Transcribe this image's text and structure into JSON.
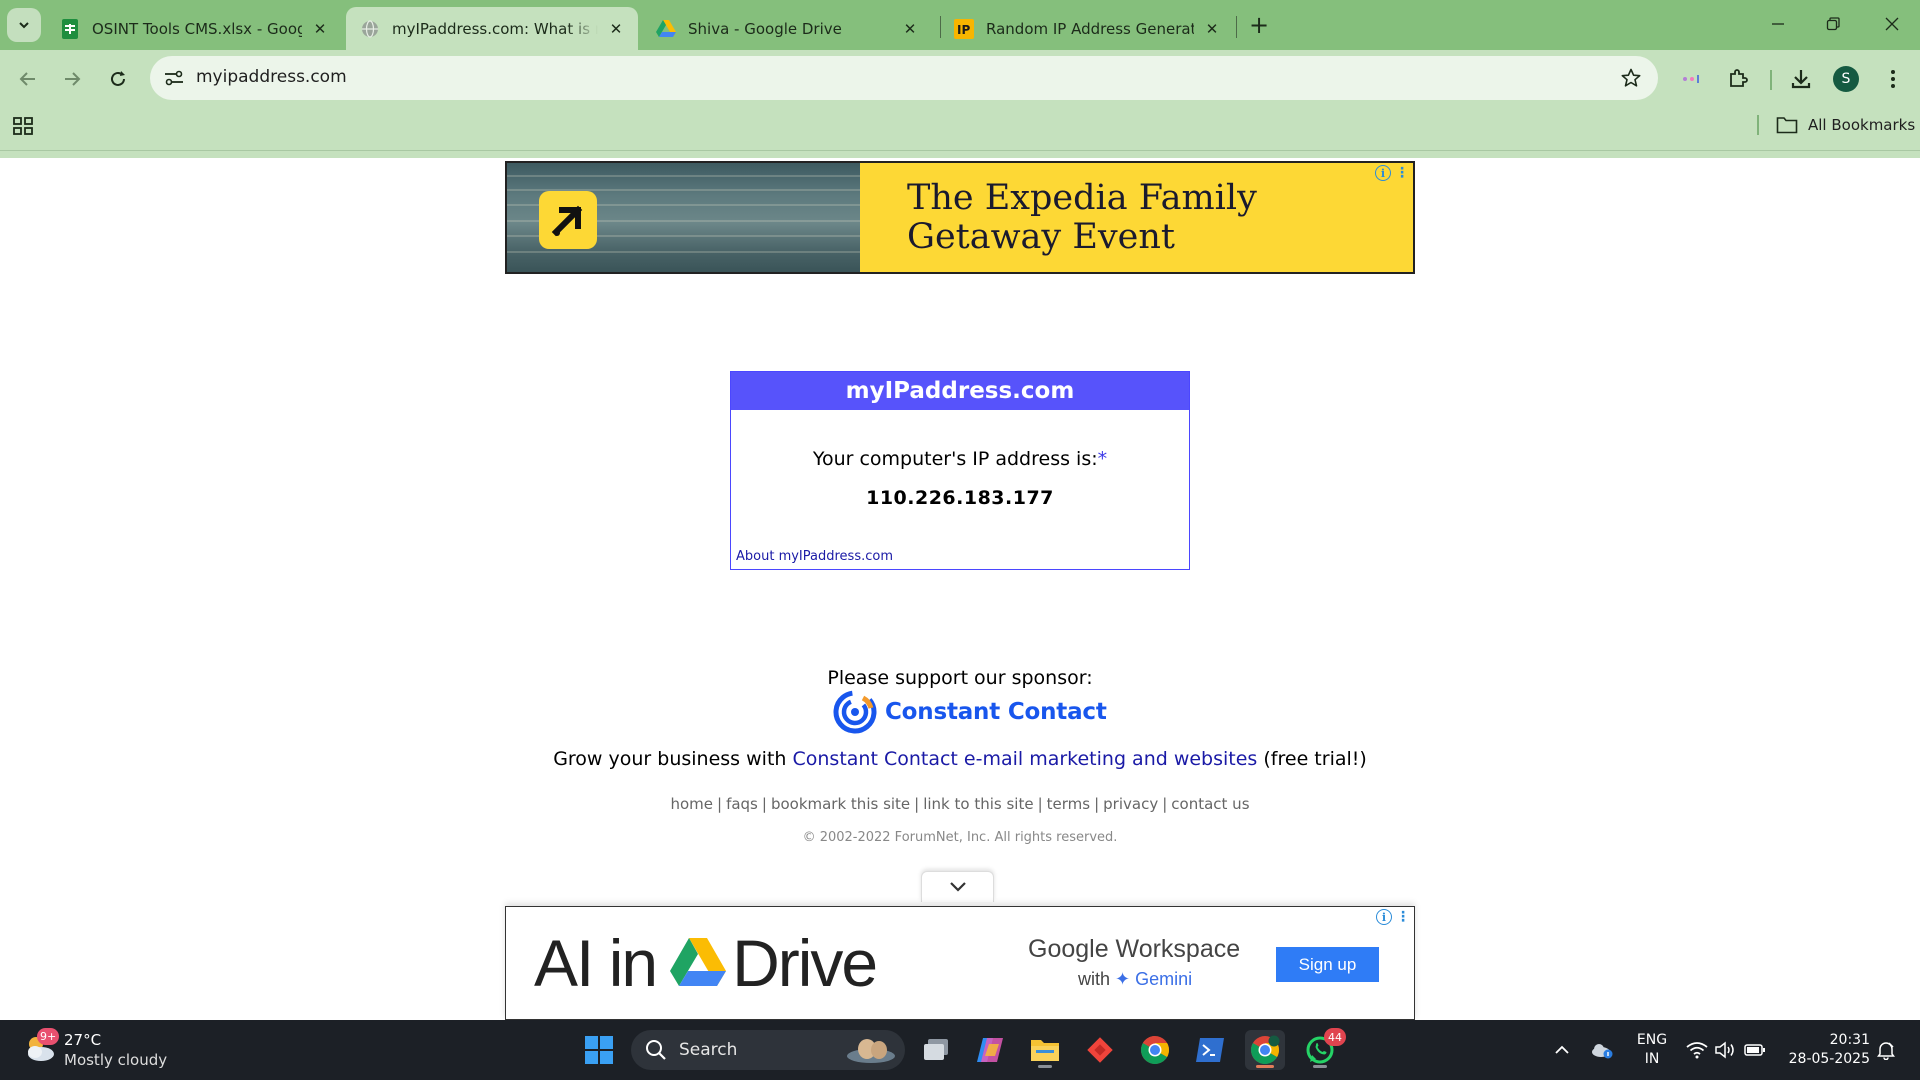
{
  "browser": {
    "tabs": [
      {
        "title": "OSINT Tools CMS.xlsx - Google",
        "icon": "google-sheets-icon",
        "active": false
      },
      {
        "title": "myIPaddress.com: What is my IP",
        "icon": "globe-icon",
        "active": true
      },
      {
        "title": "Shiva - Google Drive",
        "icon": "google-drive-icon",
        "active": false
      },
      {
        "title": "Random IP Address Generator,",
        "icon": "ip-favicon-icon",
        "active": false
      }
    ],
    "close_glyph": "✕",
    "new_tab_glyph": "+",
    "address": "myipaddress.com",
    "profile_initial": "S",
    "all_bookmarks_label": "All Bookmarks",
    "theme_color": "#85bf7c"
  },
  "ads": {
    "top": {
      "headline_line1": "The Expedia Family",
      "headline_line2": "Getaway Event",
      "background_color": "#fdd835"
    },
    "bottom": {
      "headline_prefix": "AI in",
      "headline_suffix": "Drive",
      "product": "Google Workspace",
      "with_label": "with",
      "gemini_label": "✦ Gemini",
      "cta": "Sign up"
    },
    "info_glyph": "i",
    "menu_glyph": "⋮"
  },
  "ip_box": {
    "title": "myIPaddress.com",
    "label": "Your computer's IP address is:",
    "asterisk": "*",
    "ip": "110.226.183.177",
    "about_link": "About myIPaddress.com",
    "header_color": "#5753fb"
  },
  "sponsor": {
    "label": "Please support our sponsor:",
    "brand": "Constant Contact",
    "grow_prefix": "Grow your business with",
    "grow_link": "Constant Contact e-mail marketing and websites",
    "grow_suffix": "(free trial!)"
  },
  "footer": {
    "links": [
      "home",
      "faqs",
      "bookmark this site",
      "link to this site",
      "terms",
      "privacy",
      "contact us"
    ],
    "separator": "|",
    "copyright": "© 2002-2022 ForumNet, Inc. All rights reserved."
  },
  "taskbar": {
    "weather_badge": "9+",
    "temperature": "27°C",
    "condition": "Mostly cloudy",
    "search_label": "Search",
    "whatsapp_badge": "44",
    "language_line1": "ENG",
    "language_line2": "IN",
    "time": "20:31",
    "date": "28-05-2025"
  }
}
